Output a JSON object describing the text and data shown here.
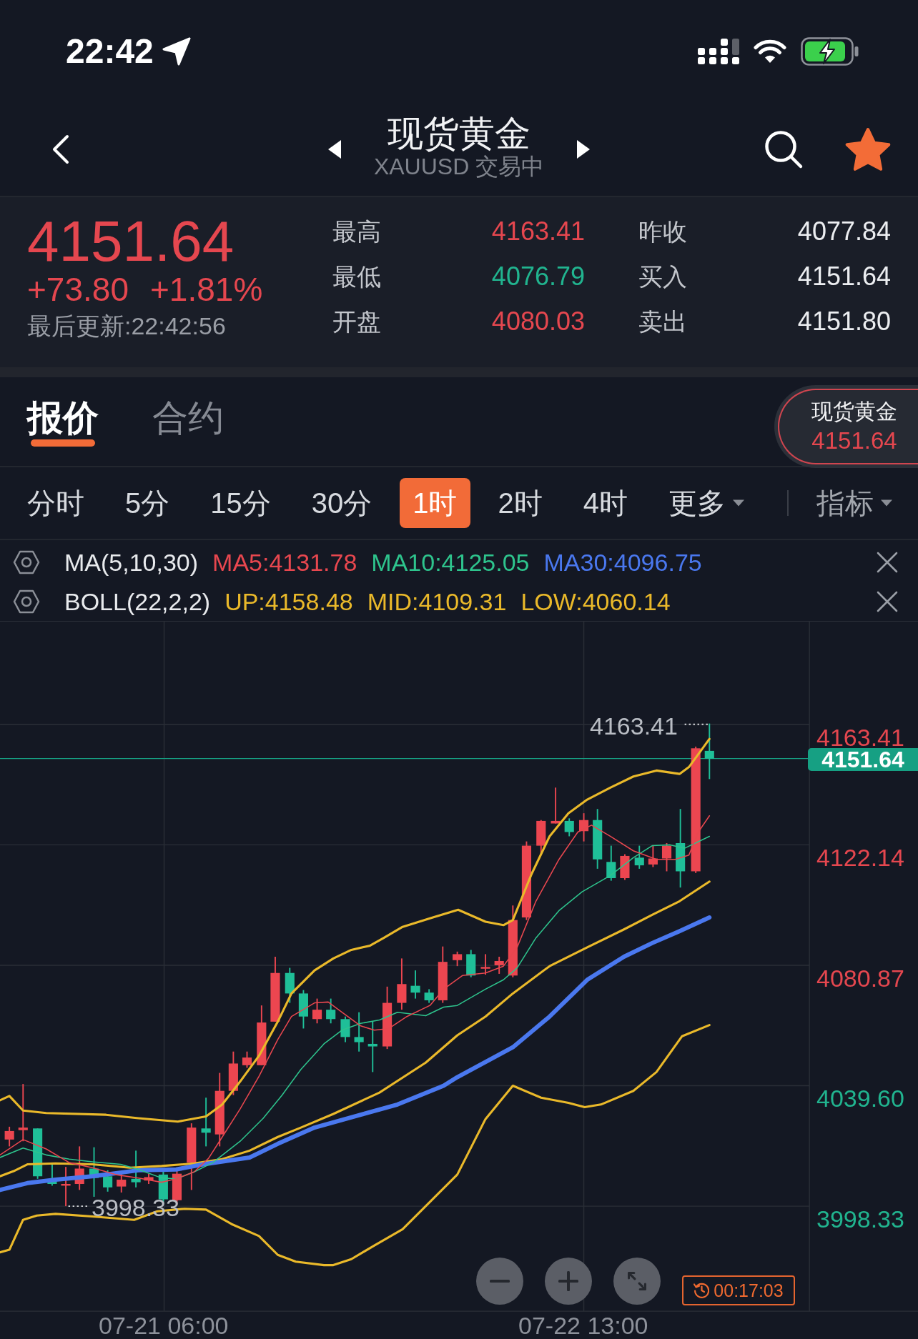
{
  "status_bar": {
    "time": "22:42"
  },
  "nav": {
    "title": "现货黄金",
    "subtitle": "XAUUSD 交易中",
    "favorite": true
  },
  "quote": {
    "price": "4151.64",
    "rising": true,
    "change": "+73.80",
    "change_percent": "+1.81%",
    "updated": "最后更新:22:42:56",
    "stats": [
      {
        "label": "最高",
        "value": "4163.41",
        "color": "#e5474f"
      },
      {
        "label": "昨收",
        "value": "4077.84",
        "color": "#eceef1"
      },
      {
        "label": "最低",
        "value": "4076.79",
        "color": "#21b48f"
      },
      {
        "label": "买入",
        "value": "4151.64",
        "color": "#eceef1"
      },
      {
        "label": "开盘",
        "value": "4080.03",
        "color": "#e5474f"
      },
      {
        "label": "卖出",
        "value": "4151.80",
        "color": "#eceef1"
      }
    ]
  },
  "tabs": [
    {
      "label": "报价",
      "selected": true
    },
    {
      "label": "合约",
      "selected": false
    }
  ],
  "pinned_quote": {
    "name": "现货黄金",
    "price": "4151.64",
    "rising": true
  },
  "timeframes": [
    {
      "label": "分时",
      "kind": "option",
      "selected": false
    },
    {
      "label": "5分",
      "kind": "option",
      "selected": false
    },
    {
      "label": "15分",
      "kind": "option",
      "selected": false
    },
    {
      "label": "30分",
      "kind": "option",
      "selected": false
    },
    {
      "label": "1时",
      "kind": "option",
      "selected": true
    },
    {
      "label": "2时",
      "kind": "option",
      "selected": false
    },
    {
      "label": "4时",
      "kind": "option",
      "selected": false
    },
    {
      "label": "更多",
      "kind": "dropdown",
      "selected": false
    }
  ],
  "indicator_menu": {
    "label": "指标"
  },
  "indicators": [
    {
      "name": "MA(5,10,30)",
      "values": [
        {
          "text": "MA5:4131.78",
          "color": "#e8474f"
        },
        {
          "text": "MA10:4125.05",
          "color": "#2ec48d"
        },
        {
          "text": "MA30:4096.75",
          "color": "#4a78ef"
        }
      ]
    },
    {
      "name": "BOLL(22,2,2)",
      "values": [
        {
          "text": "UP:4158.48",
          "color": "#eab92a"
        },
        {
          "text": "MID:4109.31",
          "color": "#eab92a"
        },
        {
          "text": "LOW:4060.14",
          "color": "#eab92a"
        }
      ]
    }
  ],
  "chart": {
    "high_marker": "4163.41",
    "low_marker": "3998.33",
    "last_price": "4151.64",
    "y_axis": [
      {
        "label": "4163.41",
        "color": "#e5474f"
      },
      {
        "label": "4122.14",
        "color": "#e5474f"
      },
      {
        "label": "4080.87",
        "color": "#e5474f"
      },
      {
        "label": "4039.60",
        "color": "#21b48f"
      },
      {
        "label": "3998.33",
        "color": "#21b48f"
      }
    ],
    "x_axis": [
      "07-21 06:00",
      "07-22 13:00"
    ],
    "countdown": "00:17:03"
  }
}
